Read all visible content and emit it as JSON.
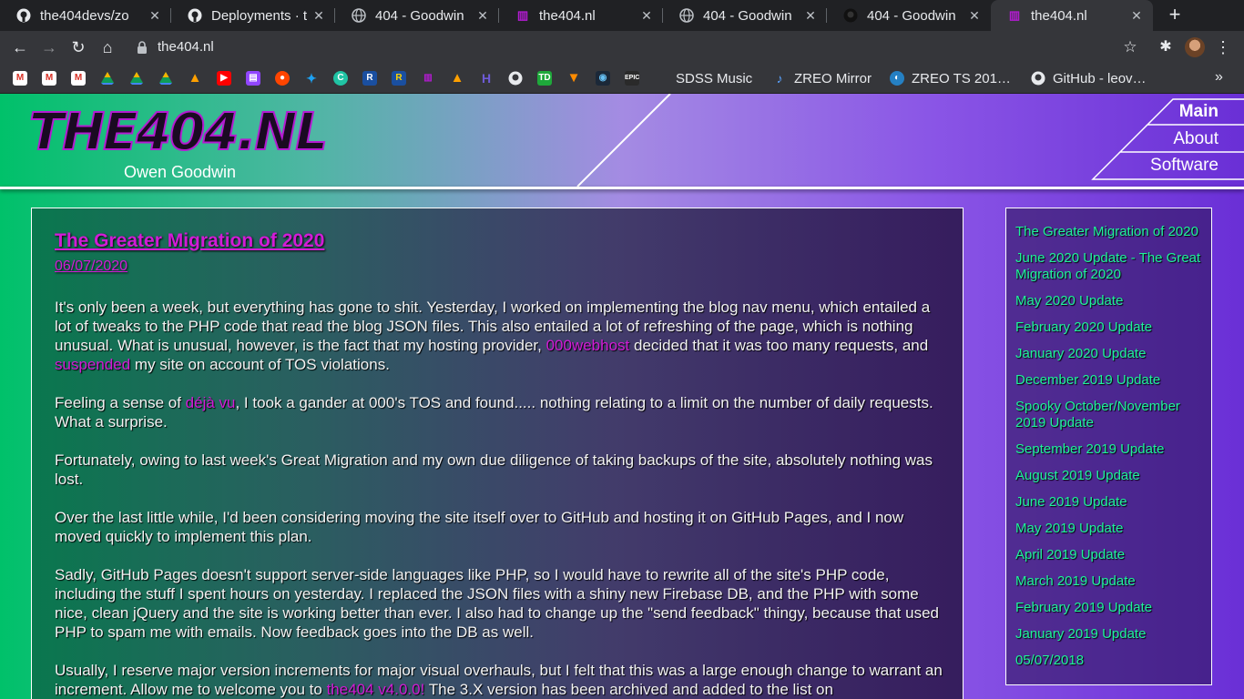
{
  "browser": {
    "tabs": [
      {
        "title": "the404devs/zo",
        "icon": "github-icon"
      },
      {
        "title": "Deployments · t",
        "icon": "github-icon"
      },
      {
        "title": "404 - Goodwin",
        "icon": "globe-icon"
      },
      {
        "title": "the404.nl",
        "icon": "the404-icon"
      },
      {
        "title": "404 - Goodwin",
        "icon": "globe-icon"
      },
      {
        "title": "404 - Goodwin",
        "icon": "github-icon"
      },
      {
        "title": "the404.nl",
        "icon": "the404-icon"
      }
    ],
    "url": "the404.nl",
    "bookmarks": [
      {
        "label": "SDSS Music",
        "icon": "none"
      },
      {
        "label": "ZREO Mirror",
        "icon": "music-note-icon"
      },
      {
        "label": "ZREO TS 201…",
        "icon": "teamspeak-icon"
      },
      {
        "label": "GitHub - leov…",
        "icon": "github-icon"
      }
    ]
  },
  "site": {
    "logo": "THE404.NL",
    "author": "Owen Goodwin",
    "nav": [
      "Main",
      "About",
      "Software"
    ]
  },
  "post": {
    "title": "The Greater Migration of 2020",
    "date": "06/07/2020",
    "p1": {
      "a": "It's only been a week, but everything has gone to shit. Yesterday, I worked on implementing the blog nav menu, which entailed a lot of tweaks to the PHP code that read the blog JSON files. This also entailed a lot of refreshing of the page, which is nothing unusual. What is unusual, however, is the fact that my hosting provider, ",
      "link1": "000webhost",
      "b": " decided that it was too many requests, and ",
      "link2": "suspended",
      "c": " my site on account of TOS violations."
    },
    "p2": {
      "a": "Feeling a sense of ",
      "link": "déjà vu",
      "b": ", I took a gander at 000's TOS and found..... nothing relating to a limit on the number of daily requests. What a surprise."
    },
    "p3": "Fortunately, owing to last week's Great Migration and my own due diligence of taking backups of the site, absolutely nothing was lost.",
    "p4": "Over the last little while, I'd been considering moving the site itself over to GitHub and hosting it on GitHub Pages, and I now moved quickly to implement this plan.",
    "p5": "Sadly, GitHub Pages doesn't support server-side languages like PHP, so I would have to rewrite all of the site's PHP code, including the stuff I spent hours on yesterday. I replaced the JSON files with a shiny new Firebase DB, and the PHP with some nice, clean jQuery and the site is working better than ever. I also had to change up the \"send feedback\" thingy, because that used PHP to spam me with emails. Now feedback goes into the DB as well.",
    "p6": {
      "a": "Usually, I reserve major version increments for major visual overhauls, but I felt that this was a large enough change to warrant an increment. Allow me to welcome you to ",
      "link": "the404 v4.0.0!",
      "b": " The 3.X version has been archived and added to the list on"
    }
  },
  "sidebar": [
    "The Greater Migration of 2020",
    "June 2020 Update - The Great Migration of 2020",
    "May 2020 Update",
    "February 2020 Update",
    "January 2020 Update",
    "December 2019 Update",
    "Spooky October/November 2019 Update",
    "September 2019 Update",
    "August 2019 Update",
    "June 2019 Update",
    "May 2019 Update",
    "April 2019 Update",
    "March 2019 Update",
    "February 2019 Update",
    "January 2019 Update",
    "05/07/2018"
  ]
}
